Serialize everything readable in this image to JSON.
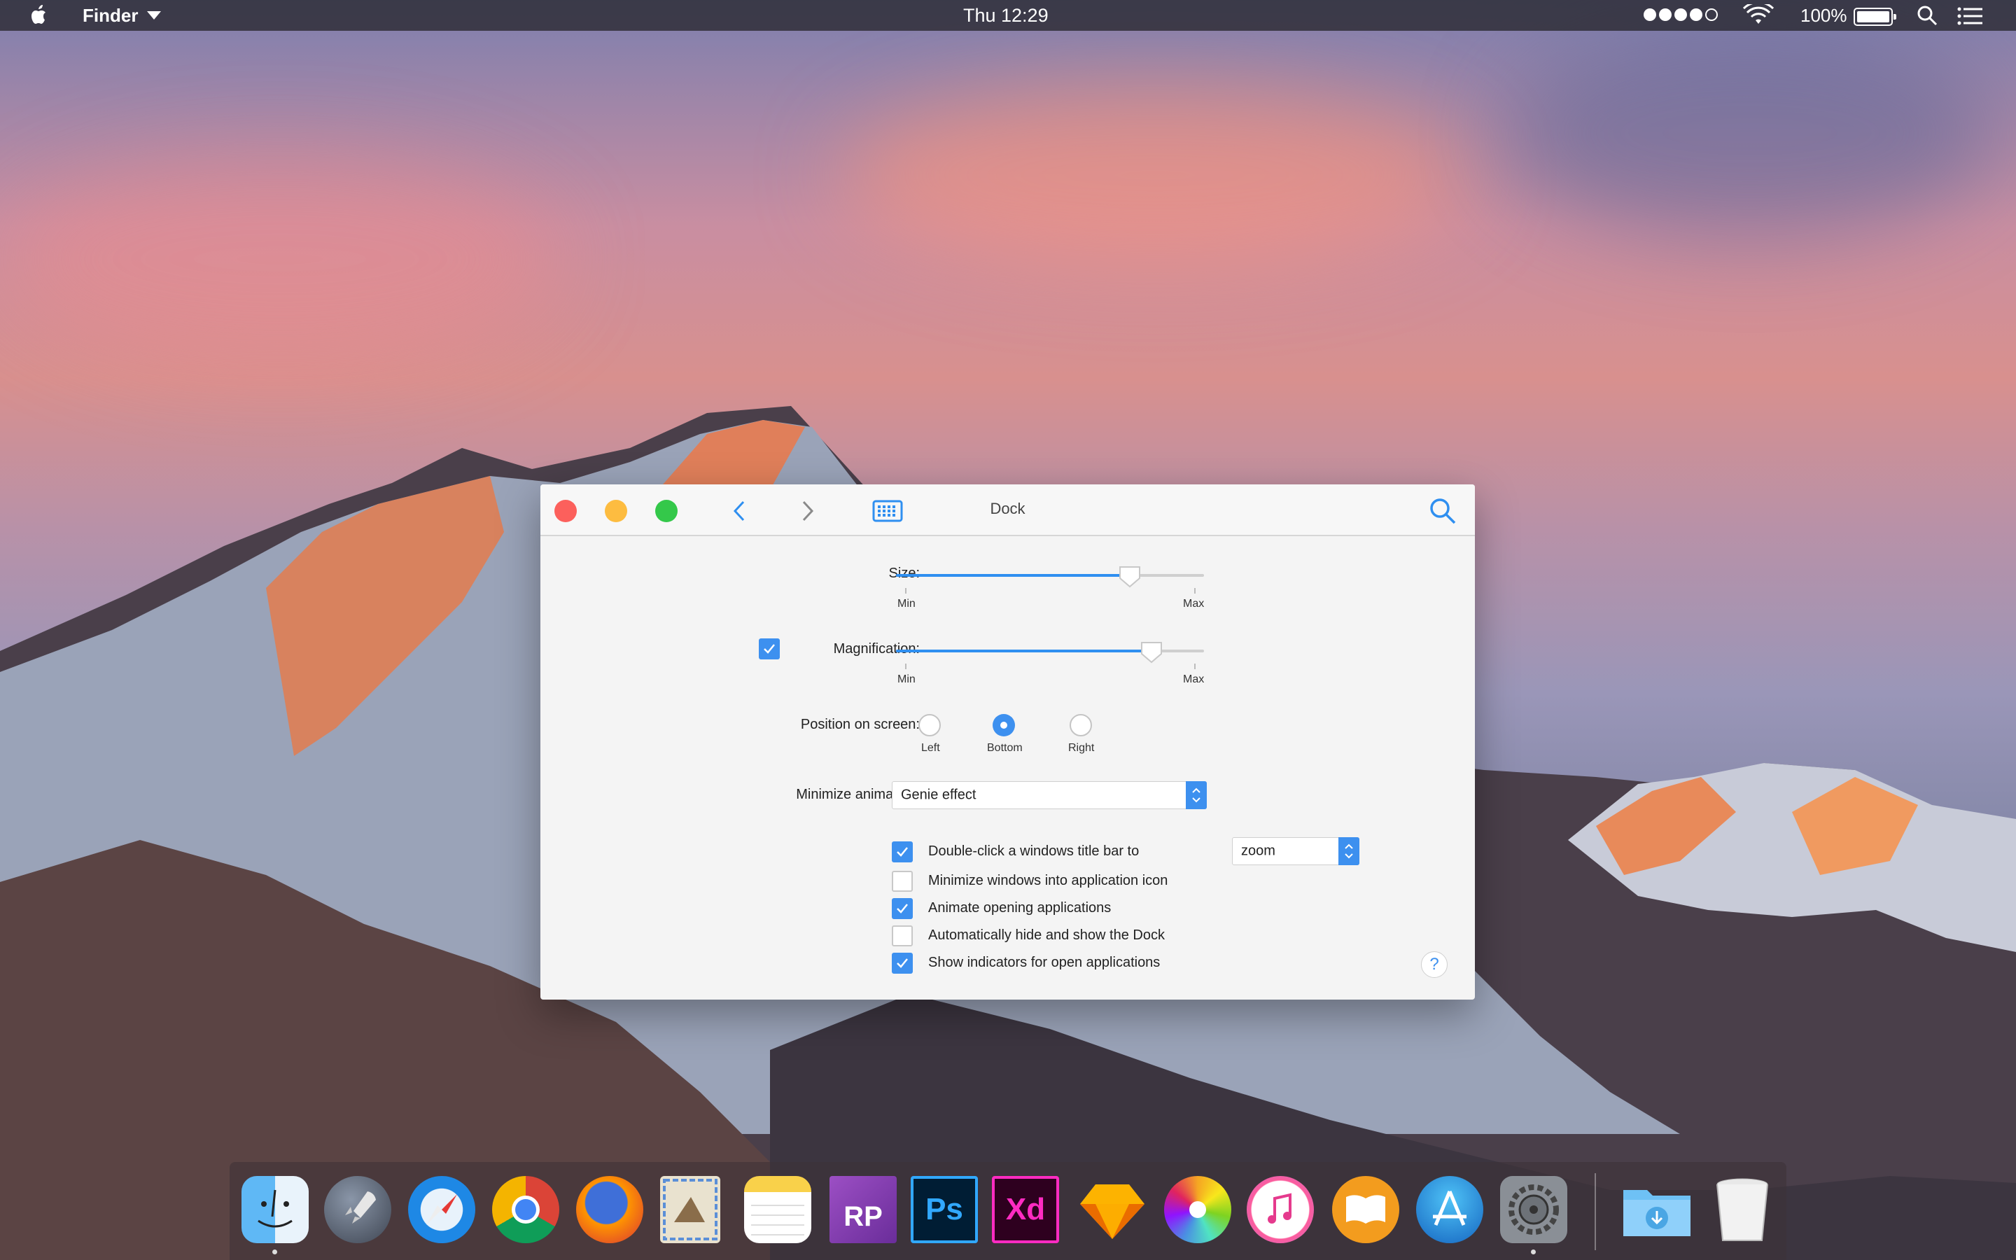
{
  "menubar": {
    "app_name": "Finder",
    "clock": "Thu 12:29",
    "battery_percent": "100%",
    "signal_bars_filled": 4,
    "signal_bars_total": 5
  },
  "window": {
    "title": "Dock",
    "size": {
      "label": "Size:",
      "min": "Min",
      "max": "Max",
      "value": 0.76
    },
    "magnification": {
      "label": "Magnification:",
      "checked": true,
      "min": "Min",
      "max": "Max",
      "value": 0.83
    },
    "position": {
      "label": "Position on screen:",
      "options": [
        "Left",
        "Bottom",
        "Right"
      ],
      "selected": "Bottom"
    },
    "minimize": {
      "label": "Minimize animation:",
      "value": "Genie effect"
    },
    "double_click": {
      "label": "Double-click a windows title bar to",
      "checked": true,
      "value": "zoom"
    },
    "options": [
      {
        "label": "Minimize windows into application icon",
        "checked": false
      },
      {
        "label": "Animate opening applications",
        "checked": true
      },
      {
        "label": "Automatically hide and show the Dock",
        "checked": false
      },
      {
        "label": "Show indicators for open applications",
        "checked": true
      }
    ],
    "help": "?"
  },
  "dock": {
    "items": [
      {
        "name": "finder-icon",
        "running": true
      },
      {
        "name": "launchpad-icon",
        "running": false
      },
      {
        "name": "safari-icon",
        "running": false
      },
      {
        "name": "chrome-icon",
        "running": false
      },
      {
        "name": "firefox-icon",
        "running": false
      },
      {
        "name": "mail-icon",
        "running": false
      },
      {
        "name": "notes-icon",
        "running": false
      },
      {
        "name": "axure-rp-icon",
        "text": "RP",
        "running": false
      },
      {
        "name": "photoshop-icon",
        "text": "Ps",
        "running": false
      },
      {
        "name": "adobe-xd-icon",
        "text": "Xd",
        "running": false
      },
      {
        "name": "sketch-icon",
        "running": false
      },
      {
        "name": "photos-icon",
        "running": false
      },
      {
        "name": "itunes-icon",
        "running": false
      },
      {
        "name": "ibooks-icon",
        "running": false
      },
      {
        "name": "app-store-icon",
        "running": false
      },
      {
        "name": "system-preferences-icon",
        "running": true
      },
      {
        "name": "downloads-folder-icon",
        "running": false
      },
      {
        "name": "trash-icon",
        "running": false
      }
    ]
  },
  "colors": {
    "accent": "#3d90ef",
    "close": "#fc605c",
    "minimize": "#fdbc40",
    "maximize": "#34c84a"
  }
}
